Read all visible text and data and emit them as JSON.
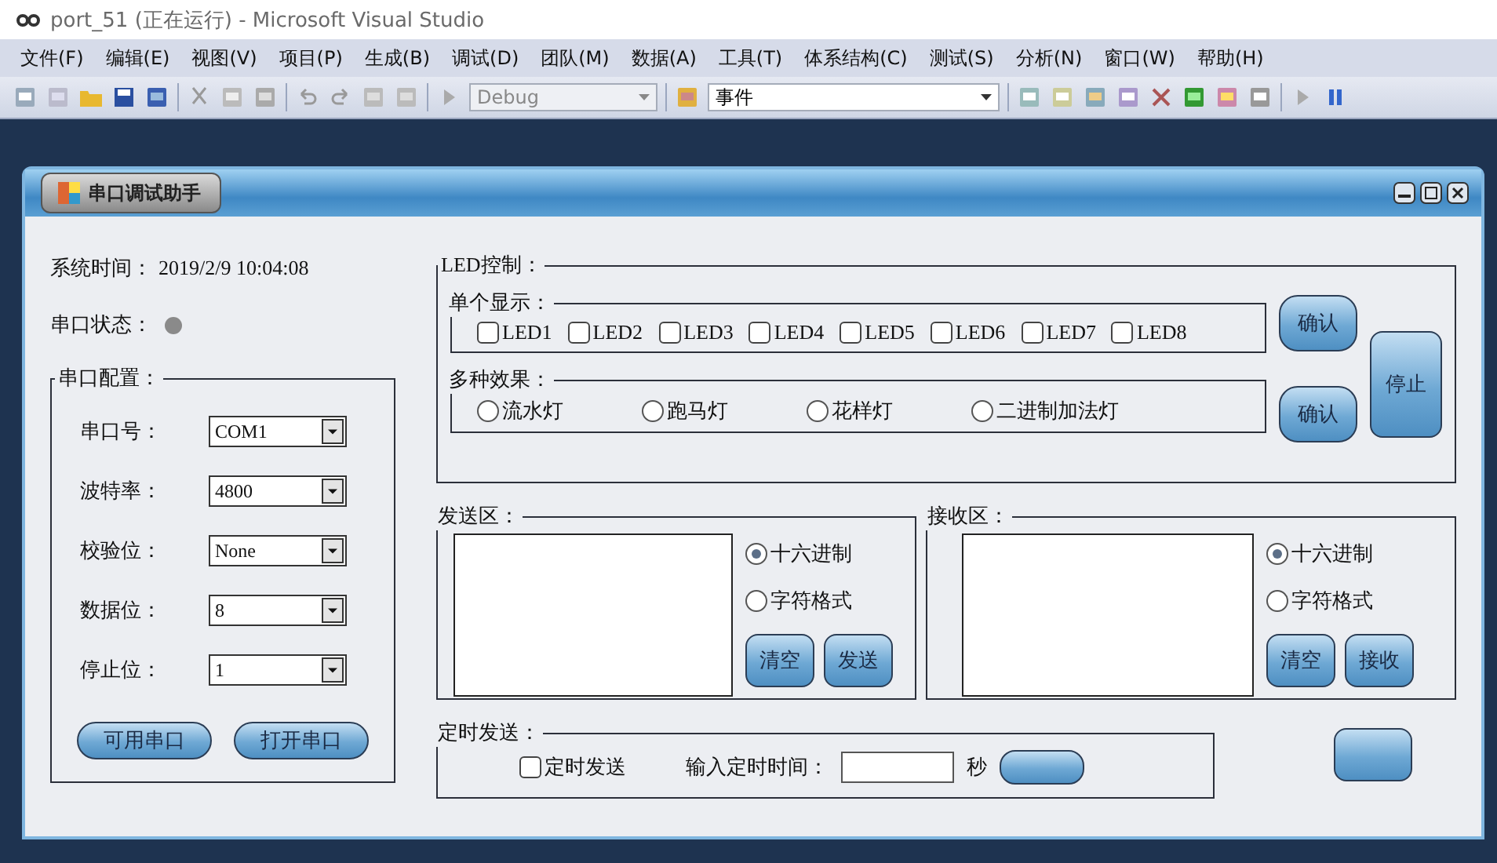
{
  "window": {
    "title": "port_51 (正在运行) - Microsoft Visual Studio"
  },
  "menu": [
    "文件(F)",
    "编辑(E)",
    "视图(V)",
    "项目(P)",
    "生成(B)",
    "调试(D)",
    "团队(M)",
    "数据(A)",
    "工具(T)",
    "体系结构(C)",
    "测试(S)",
    "分析(N)",
    "窗口(W)",
    "帮助(H)"
  ],
  "toolbar": {
    "configuration": "Debug",
    "event_field": "事件"
  },
  "form": {
    "title": "串口调试助手",
    "system_time": {
      "label": "系统时间：",
      "value": "2019/2/9 10:04:08"
    },
    "port_status": {
      "label": "串口状态："
    },
    "port_config": {
      "title": "串口配置：",
      "fields": [
        {
          "label": "串口号：",
          "value": "COM1"
        },
        {
          "label": "波特率：",
          "value": "4800"
        },
        {
          "label": "校验位：",
          "value": "None"
        },
        {
          "label": "数据位：",
          "value": "8"
        },
        {
          "label": "停止位：",
          "value": "1"
        }
      ],
      "buttons": [
        "可用串口",
        "打开串口"
      ]
    },
    "led_control": {
      "title": "LED控制：",
      "single": {
        "title": "单个显示：",
        "leds": [
          {
            "label": "LED1",
            "checked": false
          },
          {
            "label": "LED2",
            "checked": false
          },
          {
            "label": "LED3",
            "checked": false
          },
          {
            "label": "LED4",
            "checked": false
          },
          {
            "label": "LED5",
            "checked": false
          },
          {
            "label": "LED6",
            "checked": false
          },
          {
            "label": "LED7",
            "checked": false
          },
          {
            "label": "LED8",
            "checked": false
          }
        ],
        "confirm": "确认"
      },
      "effects": {
        "title": "多种效果：",
        "options": [
          {
            "label": "流水灯",
            "selected": false
          },
          {
            "label": "跑马灯",
            "selected": false
          },
          {
            "label": "花样灯",
            "selected": false
          },
          {
            "label": "二进制加法灯",
            "selected": false
          }
        ],
        "confirm": "确认"
      },
      "stop": "停止"
    },
    "send_area": {
      "title": "发送区：",
      "formats": [
        {
          "label": "十六进制",
          "selected": true
        },
        {
          "label": "字符格式",
          "selected": false
        }
      ],
      "buttons": [
        "清空",
        "发送"
      ]
    },
    "receive_area": {
      "title": "接收区：",
      "formats": [
        {
          "label": "十六进制",
          "selected": true
        },
        {
          "label": "字符格式",
          "selected": false
        }
      ],
      "buttons": [
        "清空",
        "接收"
      ]
    },
    "timed_send": {
      "title": "定时发送：",
      "checkbox": {
        "label": "定时发送",
        "checked": false
      },
      "interval_label": "输入定时时间：",
      "unit": "秒"
    }
  }
}
